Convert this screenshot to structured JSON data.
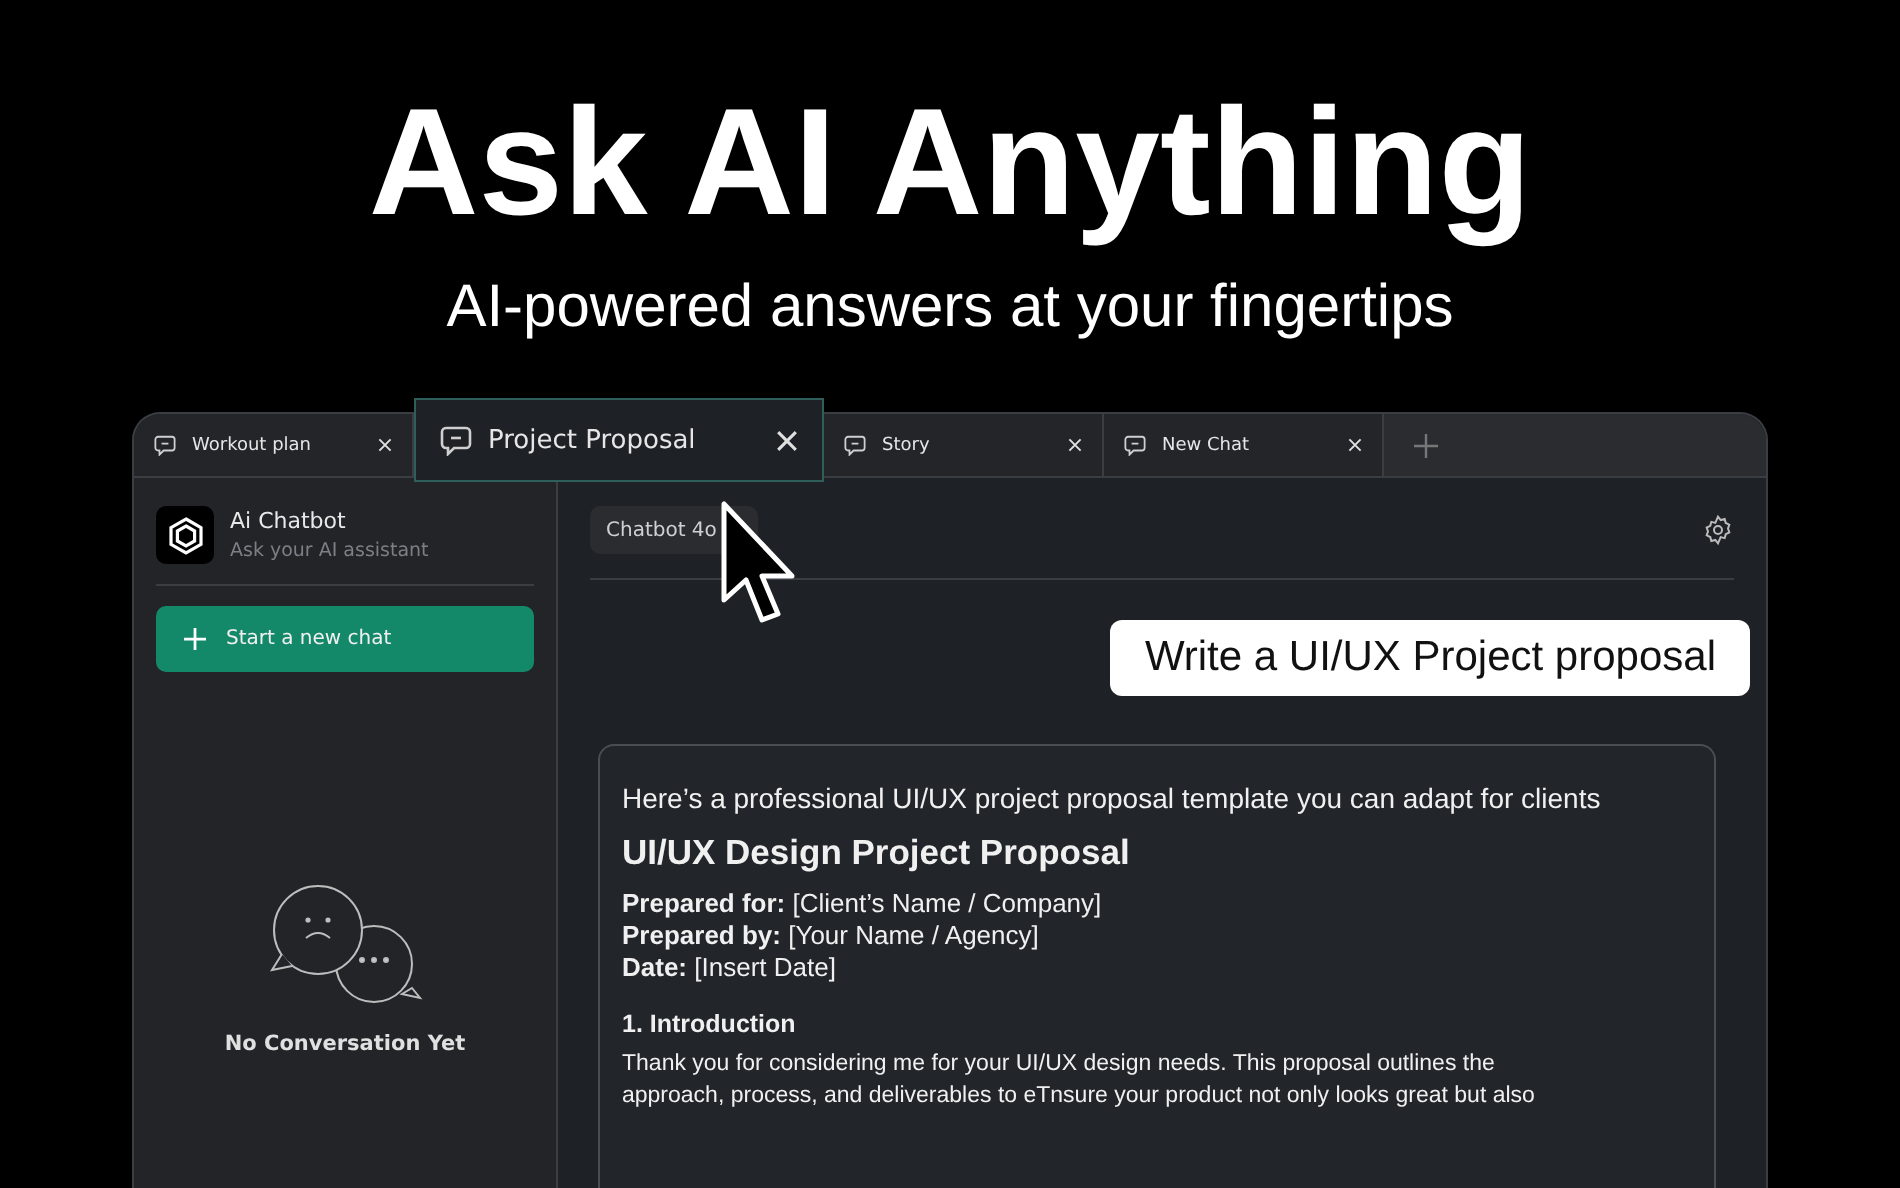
{
  "hero": {
    "headline": "Ask AI Anything",
    "subheadline": "AI-powered answers at your fingertips"
  },
  "tabs": [
    {
      "label": "Workout plan",
      "selected": false
    },
    {
      "label": "Project Proposal",
      "selected": true
    },
    {
      "label": "Story",
      "selected": false
    },
    {
      "label": "New Chat",
      "selected": false
    }
  ],
  "sidebar": {
    "app_name": "Ai Chatbot",
    "app_subtitle": "Ask your AI assistant",
    "new_chat_button": "Start a new chat",
    "empty_state": "No Conversation Yet"
  },
  "main": {
    "model_selector": "Chatbot 4o",
    "user_message": "Write a UI/UX Project proposal",
    "response": {
      "intro": "Here’s a professional UI/UX project proposal template you can adapt for clients",
      "title": "UI/UX Design Project Proposal",
      "fields": [
        {
          "label": "Prepared for:",
          "value": "[Client’s Name / Company]"
        },
        {
          "label": "Prepared by:",
          "value": "[Your Name / Agency]"
        },
        {
          "label": "Date:",
          "value": "[Insert Date]"
        }
      ],
      "sections": [
        {
          "heading": "1. Introduction",
          "body": "Thank you for considering me for your UI/UX design needs. This proposal outlines the approach, process, and deliverables to eTnsure your product not only looks great but also"
        }
      ]
    }
  }
}
